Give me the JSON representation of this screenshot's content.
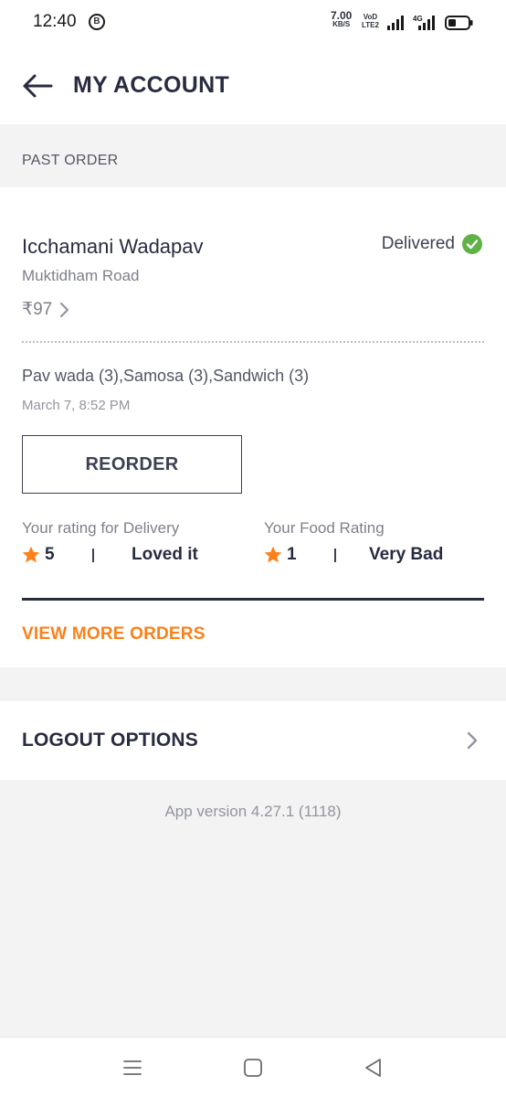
{
  "status_bar": {
    "time": "12:40",
    "b_badge": "B",
    "speed_value": "7.00",
    "speed_unit": "KB/S",
    "volte_top": "VoD",
    "volte_bottom": "LTE2",
    "network": "4G"
  },
  "header": {
    "title": "MY ACCOUNT"
  },
  "past_order": {
    "section_label": "PAST ORDER",
    "restaurant": "Icchamani Wadapav",
    "area": "Muktidham Road",
    "status": "Delivered",
    "price": "₹97",
    "items": "Pav wada (3),Samosa (3),Sandwich (3)",
    "date": "March 7, 8:52 PM",
    "reorder_label": "REORDER",
    "delivery_rating": {
      "label": "Your rating for Delivery",
      "value": "5",
      "description": "Loved it"
    },
    "food_rating": {
      "label": "Your Food Rating",
      "value": "1",
      "description": "Very Bad"
    },
    "view_more_label": "VIEW MORE ORDERS"
  },
  "logout": {
    "label": "LOGOUT OPTIONS"
  },
  "app_version": "App version 4.27.1 (1118)",
  "colors": {
    "accent": "#fc8019",
    "success": "#60b246",
    "text_dark": "#282c3f",
    "text_muted": "#7e808c"
  },
  "icons": {
    "back": "arrow-left-icon",
    "delivered": "check-circle-icon",
    "star": "star-icon",
    "chevron": "chevron-right-icon",
    "nav_menu": "menu-icon",
    "nav_home": "square-icon",
    "nav_back": "triangle-back-icon"
  }
}
